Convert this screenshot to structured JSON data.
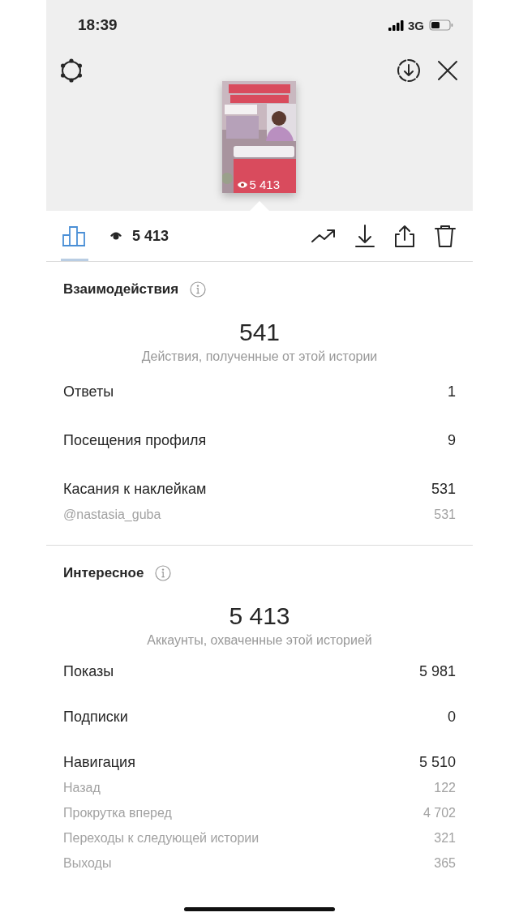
{
  "status_bar": {
    "time": "18:39",
    "network": "3G"
  },
  "header": {
    "left": [
      {
        "kind": "settings"
      }
    ],
    "right": [
      {
        "kind": "save"
      },
      {
        "kind": "close"
      }
    ],
    "story": {
      "kind": "picture",
      "views": "5 413"
    }
  },
  "tabs": [
    {
      "kind": "chart",
      "selected": true
    },
    {
      "kind": "views",
      "label": "5 413",
      "selected": false
    }
  ],
  "actions": [
    {
      "kind": "trend"
    },
    {
      "kind": "download"
    },
    {
      "kind": "share"
    },
    {
      "kind": "delete"
    }
  ],
  "sections": [
    {
      "title": "Взаимодействия",
      "total": "541",
      "caption": "Действия, полученные от этой истории",
      "rows": [
        {
          "label": "Ответы",
          "value": "1"
        },
        {
          "label": "Посещения профиля",
          "value": "9"
        },
        {
          "label": "Касания к наклейкам",
          "value": "531",
          "children": [
            {
              "label": "@nastasia_guba",
              "value": "531"
            }
          ]
        }
      ]
    },
    {
      "title": "Интересное",
      "total": "5 413",
      "caption": "Аккаунты, охваченные этой историей",
      "rows": [
        {
          "label": "Показы",
          "value": "5 981"
        },
        {
          "label": "Подписки",
          "value": "0"
        },
        {
          "label": "Навигация",
          "value": "5 510",
          "children": [
            {
              "label": "Назад",
              "value": "122"
            },
            {
              "label": "Прокрутка вперед",
              "value": "4 702"
            },
            {
              "label": "Переходы к следующей истории",
              "value": "321"
            },
            {
              "label": "Выходы",
              "value": "365"
            }
          ]
        }
      ]
    }
  ]
}
